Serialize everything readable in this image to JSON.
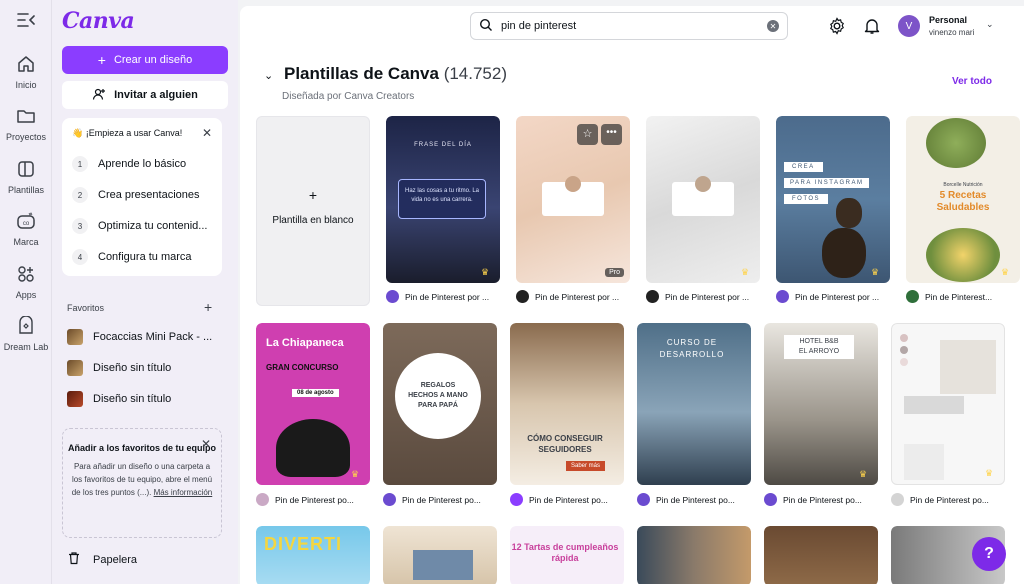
{
  "rail": {
    "items": [
      {
        "label": "Inicio",
        "icon": "home-icon"
      },
      {
        "label": "Proyectos",
        "icon": "folder-icon"
      },
      {
        "label": "Plantillas",
        "icon": "templates-icon"
      },
      {
        "label": "Marca",
        "icon": "brand-icon"
      },
      {
        "label": "Apps",
        "icon": "apps-icon"
      },
      {
        "label": "Dream Lab",
        "icon": "dream-lab-icon"
      }
    ]
  },
  "panel": {
    "logo": "Canva",
    "create_label": "Crear un diseño",
    "invite_label": "Invitar a alguien",
    "start_card": {
      "title": "👋 ¡Empieza a usar Canva!",
      "steps": [
        {
          "num": "1",
          "label": "Aprende lo básico"
        },
        {
          "num": "2",
          "label": "Crea presentaciones"
        },
        {
          "num": "3",
          "label": "Optimiza tu contenid..."
        },
        {
          "num": "4",
          "label": "Configura tu marca"
        }
      ]
    },
    "favorites_title": "Favoritos",
    "favorites": [
      {
        "label": "Focaccias Mini Pack - ..."
      },
      {
        "label": "Diseño sin título"
      },
      {
        "label": "Diseño sin título"
      }
    ],
    "team_card": {
      "title": "Añadir a los favoritos de tu equipo",
      "text": "Para añadir un diseño o una carpeta a los favoritos de tu equipo, abre el menú de los tres puntos (...).",
      "link": "Más información"
    },
    "trash_label": "Papelera"
  },
  "header": {
    "search_value": "pin de pinterest",
    "account_name": "Personal",
    "account_user": "vinenzo mari",
    "avatar_initial": "V"
  },
  "section": {
    "title": "Plantillas de Canva",
    "count": "(14.752)",
    "subtitle": "Diseñada por Canva Creators",
    "see_all": "Ver todo",
    "blank_label": "Plantilla en blanco",
    "row1": [
      {
        "label": "Pin de Pinterest por ...",
        "text": "FRASE DEL DÍA — Haz las cosas a tu ritmo. La vida no es una carrera."
      },
      {
        "label": "Pin de Pinterest por ...",
        "badge": "Pro"
      },
      {
        "label": "Pin de Pinterest por ..."
      },
      {
        "label": "Pin de Pinterest por ...",
        "text": "CREA PARA INSTAGRAM FOTOS"
      },
      {
        "label": "Pin de Pinterest...",
        "text": "5 Recetas Saludables"
      }
    ],
    "row2": [
      {
        "label": "Pin de Pinterest po...",
        "text": "La Chiapaneca GRAN CONCURSO 08 de agosto"
      },
      {
        "label": "Pin de Pinterest po...",
        "text": "REGALOS HECHOS A MANO PARA PAPÁ"
      },
      {
        "label": "Pin de Pinterest po...",
        "text": "CÓMO CONSEGUIR SEGUIDORES"
      },
      {
        "label": "Pin de Pinterest po...",
        "text": "CURSO DE DESARROLLO"
      },
      {
        "label": "Pin de Pinterest po...",
        "text": "HOTEL B&B EL ARROYO"
      },
      {
        "label": "Pin de Pinterest po..."
      }
    ],
    "row3": [
      {
        "text": "DIVERTI"
      },
      {
        "text": ""
      },
      {
        "text": "12 Tartas de cumpleaños rápida"
      },
      {
        "text": ""
      },
      {
        "text": ""
      },
      {
        "text": ""
      }
    ]
  },
  "help_label": "?"
}
